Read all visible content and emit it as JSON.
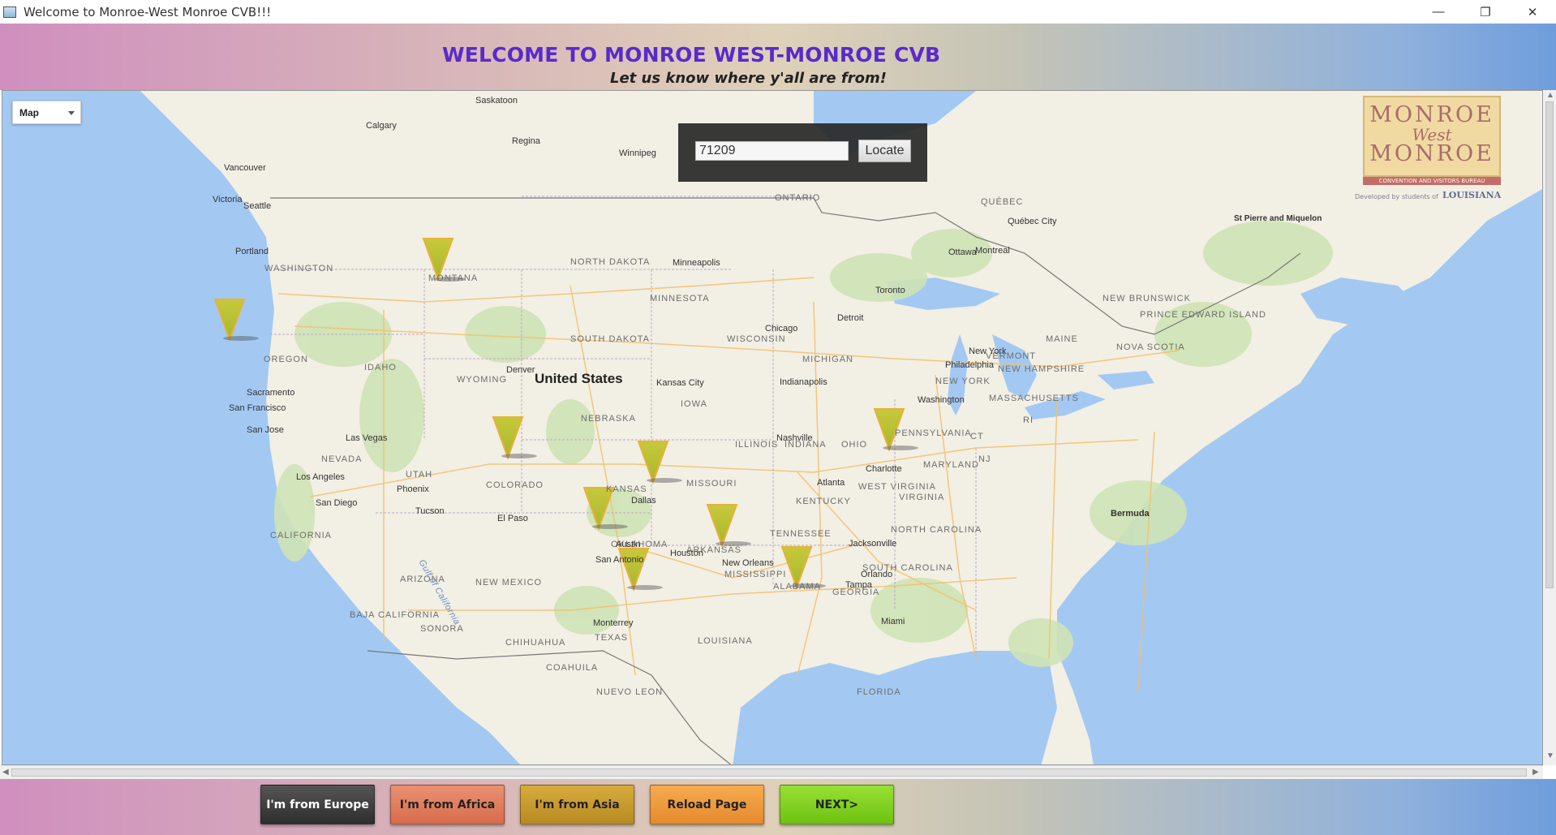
{
  "window": {
    "title": "Welcome to Monroe-West Monroe CVB!!!",
    "minimize": "—",
    "restore": "❐",
    "close": "✕"
  },
  "header": {
    "title": "WELCOME TO MONROE WEST-MONROE CVB",
    "subtitle": "Let us know where y'all are from!"
  },
  "map": {
    "map_type": "Map",
    "search": {
      "value": "71209",
      "button": "Locate"
    },
    "logo": {
      "line1": "MONROE",
      "line2": "West",
      "line3": "MONROE",
      "band": "CONVENTION AND VISITORS BUREAU",
      "developed": "Developed by students of",
      "university": "LOUISIANA"
    },
    "country_label": "United States",
    "states": [
      "WASHINGTON",
      "OREGON",
      "IDAHO",
      "MONTANA",
      "WYOMING",
      "NEVADA",
      "UTAH",
      "COLORADO",
      "CALIFORNIA",
      "ARIZONA",
      "NEW MEXICO",
      "NORTH DAKOTA",
      "SOUTH DAKOTA",
      "NEBRASKA",
      "KANSAS",
      "OKLAHOMA",
      "TEXAS",
      "MINNESOTA",
      "IOWA",
      "MISSOURI",
      "ARKANSAS",
      "LOUISIANA",
      "WISCONSIN",
      "ILLINOIS",
      "INDIANA",
      "MICHIGAN",
      "OHIO",
      "KENTUCKY",
      "TENNESSEE",
      "MISSISSIPPI",
      "ALABAMA",
      "GEORGIA",
      "FLORIDA",
      "SOUTH CAROLINA",
      "NORTH CAROLINA",
      "VIRGINIA",
      "WEST VIRGINIA",
      "PENNSYLVANIA",
      "NEW YORK",
      "MARYLAND",
      "NJ",
      "MASSACHUSETTS",
      "VERMONT",
      "NEW HAMPSHIRE",
      "MAINE",
      "RI",
      "ONTARIO",
      "QUÉBEC",
      "NEW BRUNSWICK",
      "PRINCE EDWARD ISLAND",
      "NOVA SCOTIA",
      "SONORA",
      "CHIHUAHUA",
      "COAHUILA",
      "BAJA CALIFORNIA",
      "NUEVO LEON",
      "CT"
    ],
    "cities": [
      "Calgary",
      "Saskatoon",
      "Regina",
      "Winnipeg",
      "Vancouver",
      "Victoria",
      "Seattle",
      "Portland",
      "Sacramento",
      "San Francisco",
      "San Jose",
      "Las Vegas",
      "Los Angeles",
      "San Diego",
      "Phoenix",
      "Tucson",
      "El Paso",
      "Denver",
      "Kansas City",
      "Dallas",
      "Austin",
      "San Antonio",
      "Houston",
      "New Orleans",
      "Minneapolis",
      "Chicago",
      "Detroit",
      "Indianapolis",
      "Nashville",
      "Atlanta",
      "Charlotte",
      "Jacksonville",
      "Orlando",
      "Tampa",
      "Miami",
      "Washington",
      "Philadelphia",
      "New York",
      "Toronto",
      "Ottawa",
      "Montreal",
      "Québec City",
      "Bermuda",
      "Monterrey",
      "St Pierre and Miquelon",
      "Gulf of California"
    ]
  },
  "footer": {
    "buttons": [
      {
        "label": "I'm from Europe",
        "color": "#3a3a3a"
      },
      {
        "label": "I'm from Africa",
        "color": "#e07a5a"
      },
      {
        "label": "I'm from Asia",
        "color": "#c79a2a"
      },
      {
        "label": "Reload Page",
        "color": "#ee9a3a"
      },
      {
        "label": "NEXT>",
        "color": "#7fce1a"
      }
    ]
  }
}
